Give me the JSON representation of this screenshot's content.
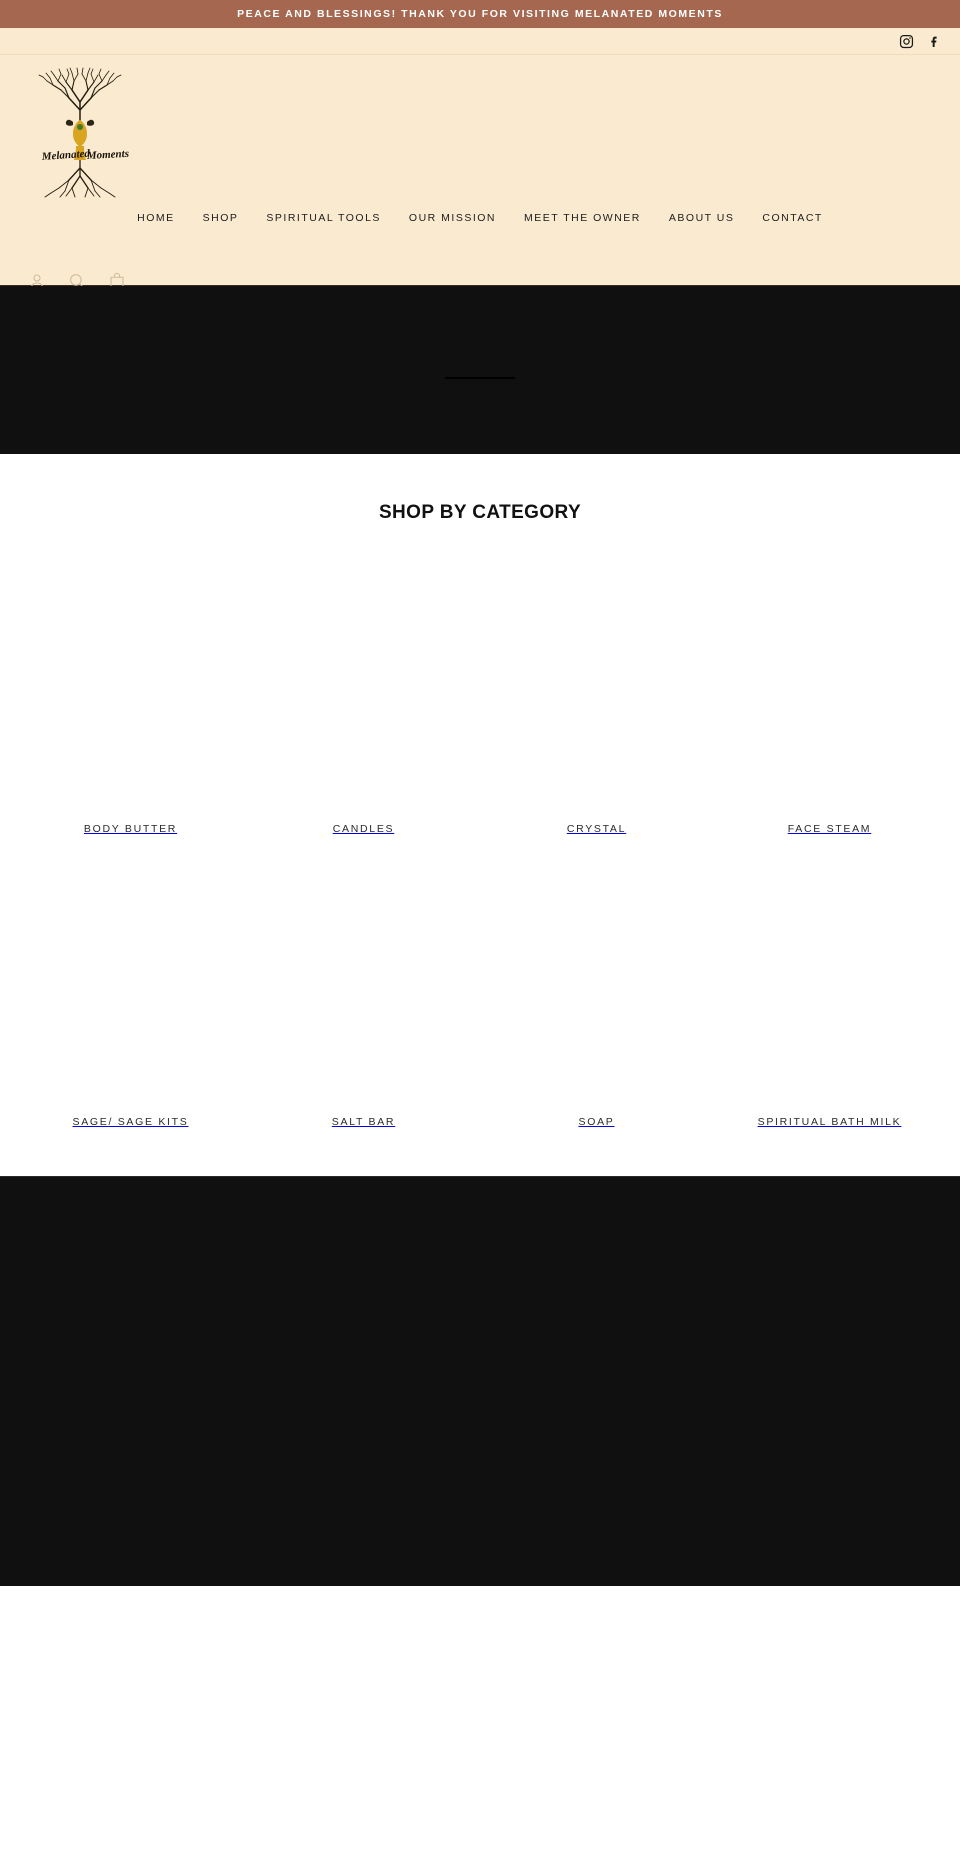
{
  "announcement": {
    "text": "PEACE AND BLESSINGS! THANK YOU FOR VISITING MELANATED MOMENTS",
    "background_color": "#a5674f",
    "text_color": "#ffffff"
  },
  "header": {
    "background_color": "#faebd0",
    "logo": {
      "name": "melanated-moments-logo",
      "script_text_left": "Melanated",
      "script_text_right": "Moments",
      "alt": "Melanated Moments"
    },
    "social": [
      {
        "name": "instagram-icon",
        "label": "Instagram"
      },
      {
        "name": "facebook-icon",
        "label": "Facebook"
      }
    ],
    "nav": [
      {
        "label": "HOME"
      },
      {
        "label": "SHOP"
      },
      {
        "label": "SPIRITUAL TOOLS"
      },
      {
        "label": "OUR MISSION"
      },
      {
        "label": "MEET THE OWNER"
      },
      {
        "label": "ABOUT US"
      },
      {
        "label": "CONTACT"
      }
    ],
    "utilities": [
      {
        "name": "account-icon",
        "label": "Account"
      },
      {
        "name": "search-icon",
        "label": "Search"
      },
      {
        "name": "cart-icon",
        "label": "Cart"
      }
    ]
  },
  "hero": {
    "background_color": "#101010"
  },
  "categories_section": {
    "title": "SHOP BY CATEGORY",
    "items": [
      {
        "label": "BODY BUTTER"
      },
      {
        "label": "CANDLES"
      },
      {
        "label": "CRYSTAL"
      },
      {
        "label": "FACE STEAM"
      },
      {
        "label": "SAGE/ SAGE KITS"
      },
      {
        "label": "SALT BAR"
      },
      {
        "label": "SOAP"
      },
      {
        "label": "SPIRITUAL BATH MILK"
      }
    ]
  },
  "lower_section": {
    "background_color": "#101010"
  }
}
